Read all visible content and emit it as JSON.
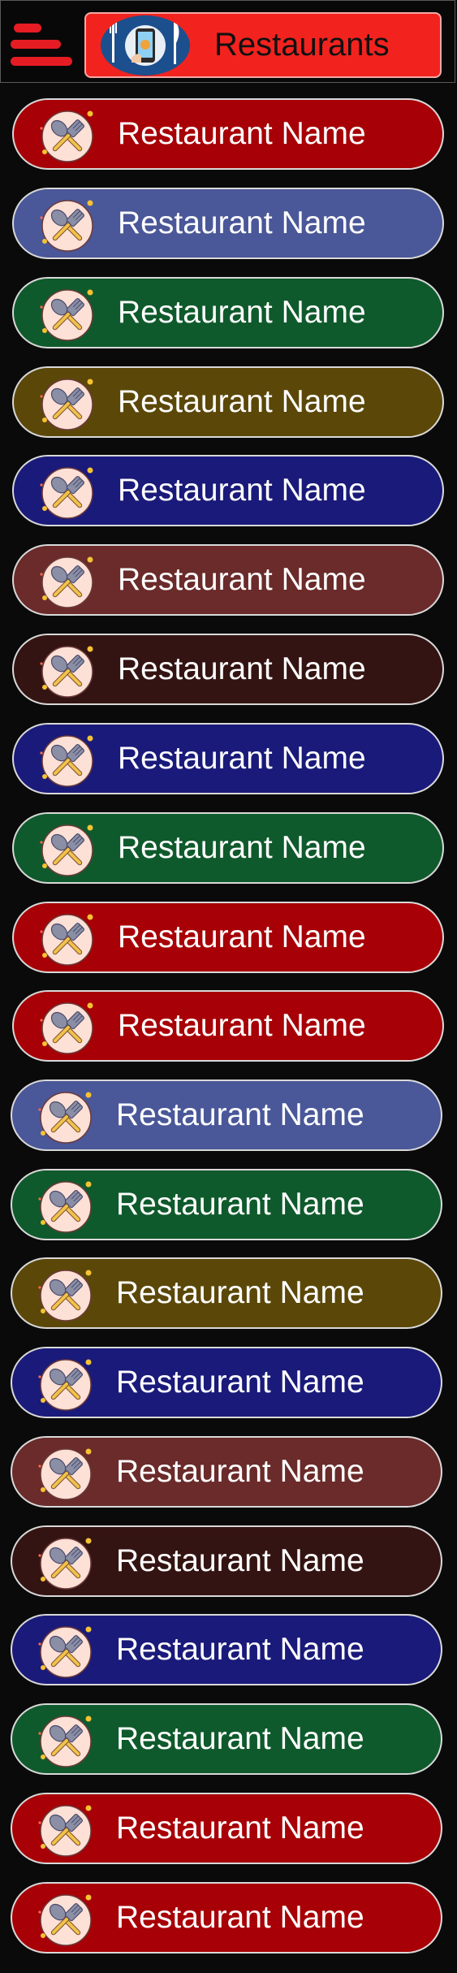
{
  "header": {
    "menu_icon": "hamburger-menu-icon",
    "logo_icon": "phone-food-order-icon",
    "title": "Restaurants",
    "title_color": "#f2231f",
    "menu_color": "#e51c23"
  },
  "restaurants": [
    {
      "name": "Restaurant Name",
      "color": "#a70006"
    },
    {
      "name": "Restaurant Name",
      "color": "#4a5798"
    },
    {
      "name": "Restaurant Name",
      "color": "#0f5a2c"
    },
    {
      "name": "Restaurant Name",
      "color": "#5b4809"
    },
    {
      "name": "Restaurant Name",
      "color": "#1a1a7a"
    },
    {
      "name": "Restaurant Name",
      "color": "#6a2b2a"
    },
    {
      "name": "Restaurant Name",
      "color": "#341412"
    },
    {
      "name": "Restaurant Name",
      "color": "#1a1a7a"
    },
    {
      "name": "Restaurant Name",
      "color": "#0f5a2c"
    },
    {
      "name": "Restaurant Name",
      "color": "#a70006"
    },
    {
      "name": "Restaurant Name",
      "color": "#a70006"
    },
    {
      "name": "Restaurant Name",
      "color": "#4a5798"
    },
    {
      "name": "Restaurant Name",
      "color": "#0f5a2c"
    },
    {
      "name": "Restaurant Name",
      "color": "#5b4809"
    },
    {
      "name": "Restaurant Name",
      "color": "#1a1a7a"
    },
    {
      "name": "Restaurant Name",
      "color": "#6a2b2a"
    },
    {
      "name": "Restaurant Name",
      "color": "#341412"
    },
    {
      "name": "Restaurant Name",
      "color": "#1a1a7a"
    },
    {
      "name": "Restaurant Name",
      "color": "#0f5a2c"
    },
    {
      "name": "Restaurant Name",
      "color": "#a70006"
    },
    {
      "name": "Restaurant Name",
      "color": "#a70006"
    }
  ],
  "card_icon": "spoon-fork-plate-icon"
}
